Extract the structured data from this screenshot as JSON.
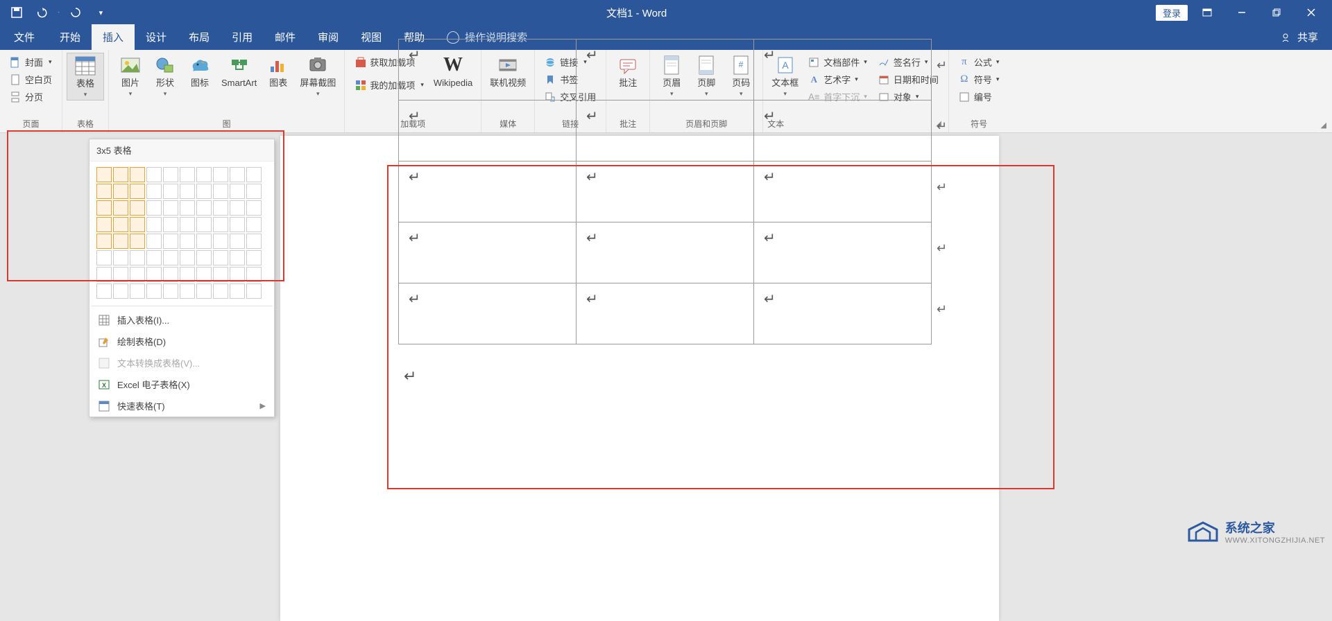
{
  "title": "文档1 - Word",
  "login": "登录",
  "tabs": [
    "文件",
    "开始",
    "插入",
    "设计",
    "布局",
    "引用",
    "邮件",
    "审阅",
    "视图",
    "帮助"
  ],
  "activeTab": 2,
  "tellMe": "操作说明搜索",
  "share": "共享",
  "groups": {
    "pages": {
      "label": "页面",
      "cover": "封面",
      "blank": "空白页",
      "break": "分页"
    },
    "tables": {
      "label": "表格",
      "btn": "表格"
    },
    "illus": {
      "label": "图",
      "pic": "图片",
      "shapes": "形状",
      "icons": "图标",
      "smartart": "SmartArt",
      "chart": "图表",
      "screenshot": "屏幕截图"
    },
    "addins": {
      "label": "加载项",
      "get": "获取加载项",
      "my": "我的加载项",
      "wiki": "Wikipedia"
    },
    "media": {
      "label": "媒体",
      "video": "联机视频"
    },
    "links": {
      "label": "链接",
      "link": "链接",
      "bookmark": "书签",
      "xref": "交叉引用"
    },
    "comments": {
      "label": "批注",
      "btn": "批注"
    },
    "hf": {
      "label": "页眉和页脚",
      "header": "页眉",
      "footer": "页脚",
      "pagenum": "页码"
    },
    "text": {
      "label": "文本",
      "textbox": "文本框",
      "quickparts": "文档部件",
      "wordart": "艺术字",
      "dropcap": "首字下沉",
      "sigline": "签名行",
      "datetime": "日期和时间",
      "object": "对象"
    },
    "symbols": {
      "label": "符号",
      "eq": "公式",
      "sym": "符号",
      "num": "编号"
    }
  },
  "dropdown": {
    "title": "3x5 表格",
    "rows": 8,
    "cols": 10,
    "selCols": 3,
    "selRows": 5,
    "insert": "插入表格(I)...",
    "draw": "绘制表格(D)",
    "convert": "文本转换成表格(V)...",
    "excel": "Excel 电子表格(X)",
    "quick": "快速表格(T)"
  },
  "table": {
    "rows": 5,
    "cols": 3
  },
  "watermark": {
    "name": "系统之家",
    "url": "WWW.XITONGZHIJIA.NET"
  }
}
